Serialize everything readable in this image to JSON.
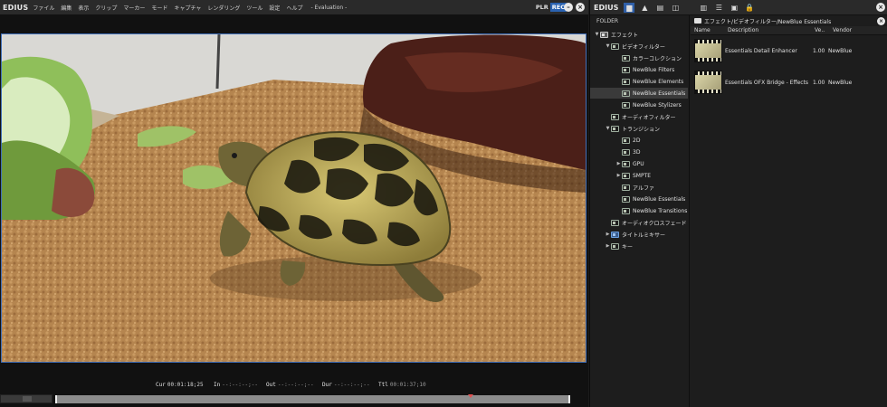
{
  "app": {
    "logo": "EDIUS",
    "menu": [
      "ファイル",
      "編集",
      "表示",
      "クリップ",
      "マーカー",
      "モード",
      "キャプチャ",
      "レンダリング",
      "ツール",
      "設定",
      "ヘルプ"
    ],
    "evaluation": "- Evaluation -",
    "mode_plr": "PLR",
    "mode_rec": "REC"
  },
  "player": {
    "timecodes": [
      {
        "label": "Cur",
        "value": "00:01:18;25"
      },
      {
        "label": "In",
        "value": "--:--:--;--"
      },
      {
        "label": "Out",
        "value": "--:--:--;--"
      },
      {
        "label": "Dur",
        "value": "--:--:--;--"
      },
      {
        "label": "Ttl",
        "value": "00:01:37;10"
      }
    ]
  },
  "palette": {
    "logo": "EDIUS",
    "folder_title": "FOLDER",
    "tree": [
      {
        "label": "エフェクト",
        "arrow": "▼",
        "icon": "folder"
      },
      {
        "label": "ビデオフィルター",
        "arrow": "▼",
        "icon": "fx"
      },
      {
        "label": "カラーコレクション",
        "arrow": "",
        "icon": "fx"
      },
      {
        "label": "NewBlue Filters",
        "arrow": "",
        "icon": "fx"
      },
      {
        "label": "NewBlue Elements",
        "arrow": "",
        "icon": "fx"
      },
      {
        "label": "NewBlue Essentials",
        "arrow": "",
        "icon": "fx"
      },
      {
        "label": "NewBlue Stylizers",
        "arrow": "",
        "icon": "fx"
      },
      {
        "label": "オーディオフィルター",
        "arrow": "",
        "icon": "fx"
      },
      {
        "label": "トランジション",
        "arrow": "▼",
        "icon": "fx"
      },
      {
        "label": "2D",
        "arrow": "",
        "icon": "fx"
      },
      {
        "label": "3D",
        "arrow": "",
        "icon": "fx"
      },
      {
        "label": "GPU",
        "arrow": "▶",
        "icon": "fx"
      },
      {
        "label": "SMPTE",
        "arrow": "▶",
        "icon": "fx"
      },
      {
        "label": "アルファ",
        "arrow": "",
        "icon": "fx"
      },
      {
        "label": "NewBlue Essentials",
        "arrow": "",
        "icon": "fx"
      },
      {
        "label": "NewBlue Transitions",
        "arrow": "",
        "icon": "fx"
      },
      {
        "label": "オーディオクロスフェード",
        "arrow": "",
        "icon": "fx"
      },
      {
        "label": "タイトルミキサー",
        "arrow": "▶",
        "icon": "title"
      },
      {
        "label": "キー",
        "arrow": "▶",
        "icon": "fx"
      }
    ],
    "path": "エフェクト/ビデオフィルター/NewBlue Essentials",
    "columns": {
      "name": "Name",
      "description": "Description",
      "version": "Ve..",
      "vendor": "Vendor"
    },
    "effects": [
      {
        "description": "Essentials Detail Enhancer",
        "version": "1.00",
        "vendor": "NewBlue"
      },
      {
        "description": "Essentials OFX Bridge - Effects",
        "version": "1.00",
        "vendor": "NewBlue"
      }
    ]
  }
}
